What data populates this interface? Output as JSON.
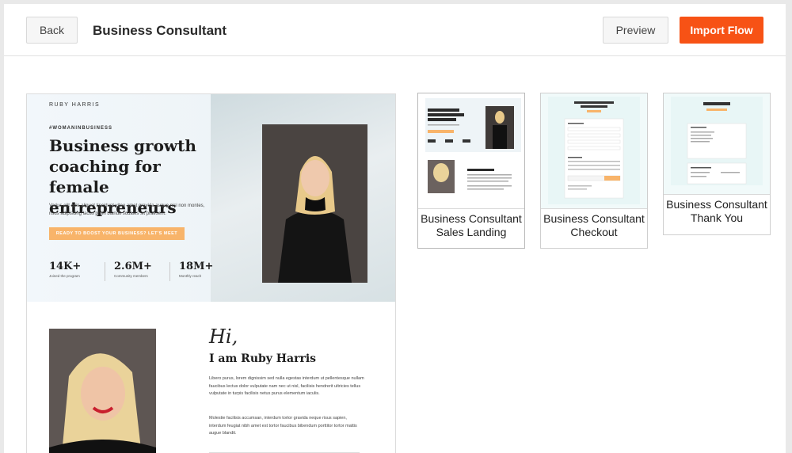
{
  "toolbar": {
    "back_label": "Back",
    "title": "Business Consultant",
    "preview_label": "Preview",
    "import_label": "Import Flow"
  },
  "colors": {
    "accent": "#f75215",
    "cta": "#f8b46a",
    "border": "#d9d9d9"
  },
  "preview_page": {
    "brand": "RUBY HARRIS",
    "tag": "#WOMANINBUSINESS",
    "headline": "Business growth coaching for female entrepreneurs",
    "body": "Varius elit quis aliquet tincidunt vitae amet gravida augue nisi non montes, risus adipiscing lacus proin blandit sodales sit praesent.",
    "cta": "READY TO BOOST YOUR BUSINESS? LET'S MEET",
    "stats": [
      {
        "value": "14K+",
        "label": "Joined the program"
      },
      {
        "value": "2.6M+",
        "label": "Community members"
      },
      {
        "value": "18M+",
        "label": "Monthly reach"
      }
    ],
    "hi": "Hi,",
    "iam": "I am Ruby Harris",
    "about_p1": "Libero purus, lorem dignissim sed nulla egestas interdum ut pellentesque nullam faucibus lectus dolor vulputate nam nec ut nisl, facilisis hendrerit ultricies tellus vulputate in turpis facilisis netus purus elementum iaculis.",
    "about_p2": "Molestie facilisis accumsan, interdum tortor gravida neque risus sapien, interdum feugiat nibh amet est tortor faucibus bibendum porttitor tortor mattis augue blandit."
  },
  "templates": [
    {
      "label": "Business Consultant Sales Landing"
    },
    {
      "label": "Business Consultant Checkout"
    },
    {
      "label": "Business Consultant Thank You"
    }
  ]
}
